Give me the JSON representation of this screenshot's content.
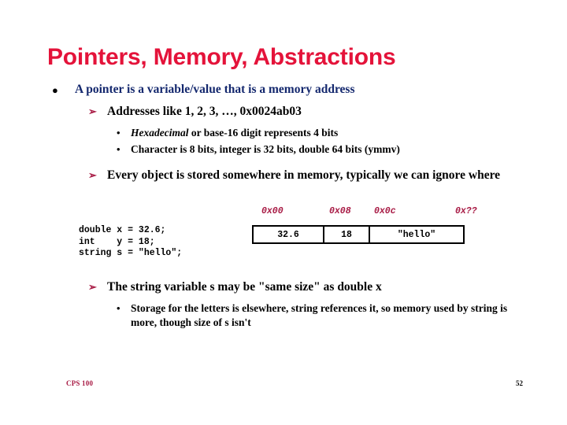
{
  "slide": {
    "title": "Pointers, Memory, Abstractions",
    "bullets": {
      "main": {
        "marker": "bullet-dot-icon",
        "marker_glyph": "●",
        "text": "A pointer is a variable/value that is a memory address"
      },
      "sub1": {
        "marker": "arrow-bullet-icon",
        "marker_glyph": "➢",
        "text": "Addresses like 1, 2, 3, …, 0x0024ab03"
      },
      "sub1_items": [
        {
          "marker": "small-dot-bullet-icon",
          "marker_glyph": "•",
          "italic_lead": "Hexadecimal",
          "rest": " or base-16 digit represents 4 bits"
        },
        {
          "marker": "small-dot-bullet-icon",
          "marker_glyph": "•",
          "italic_lead": "",
          "rest": "Character is 8 bits, integer is 32 bits, double 64  bits (ymmv)"
        }
      ],
      "sub2": {
        "marker": "arrow-bullet-icon",
        "marker_glyph": "➢",
        "text": "Every object is stored somewhere in memory, typically we can ignore where"
      },
      "sub3": {
        "marker": "arrow-bullet-icon",
        "marker_glyph": "➢",
        "text": "The string variable s may be \"same size\" as double x"
      },
      "sub3_items": [
        {
          "marker": "small-dot-bullet-icon",
          "marker_glyph": "•",
          "italic_lead": "",
          "rest": "Storage for the letters is elsewhere, string references it, so memory used by string is more, though size of s isn't"
        }
      ]
    },
    "code": "double x = 32.6;\nint    y = 18;\nstring s = \"hello\";",
    "memory": {
      "addresses": [
        "0x00",
        "0x08",
        "0x0c",
        "0x??"
      ],
      "cells": [
        "32.6",
        "18",
        "\"hello\""
      ]
    },
    "footer": {
      "course": "CPS 100",
      "page_number": "52"
    },
    "colors": {
      "title_red": "#E4133A",
      "bullet_navy": "#14286E",
      "accent_crimson": "#A81B45",
      "text_black": "#000000",
      "background": "#FFFFFF"
    }
  }
}
